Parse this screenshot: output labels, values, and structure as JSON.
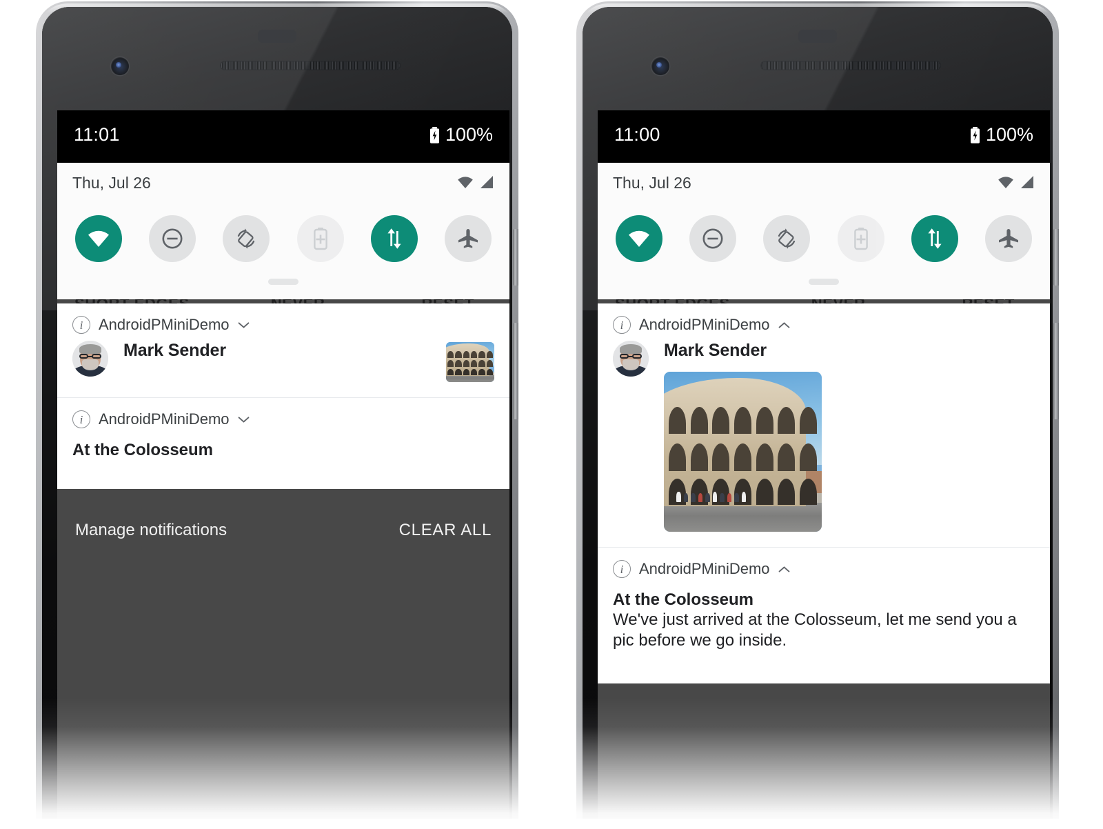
{
  "phones": [
    {
      "id": "left",
      "variant": "collapsed",
      "status_bar": {
        "time": "11:01",
        "battery": "100%",
        "battery_icon": "battery-charging-icon"
      },
      "background_app": {
        "buttons": [
          "SHORT EDGES",
          "NEVER",
          "RESET"
        ]
      },
      "quick_settings": {
        "date": "Thu, Jul 26",
        "status_icons": [
          "wifi-icon",
          "signal-icon"
        ],
        "tiles": [
          {
            "name": "wifi-tile",
            "icon": "wifi-icon",
            "state": "on"
          },
          {
            "name": "dnd-tile",
            "icon": "do-not-disturb-icon",
            "state": "off"
          },
          {
            "name": "auto-rotate-tile",
            "icon": "auto-rotate-icon",
            "state": "off"
          },
          {
            "name": "battery-saver-tile",
            "icon": "battery-plus-icon",
            "state": "disabled"
          },
          {
            "name": "mobile-data-tile",
            "icon": "data-transfer-icon",
            "state": "on"
          },
          {
            "name": "airplane-tile",
            "icon": "airplane-icon",
            "state": "off"
          }
        ]
      },
      "notifications": [
        {
          "app_name": "AndroidPMiniDemo",
          "expand_icon": "chevron-down-icon",
          "kind": "messaging",
          "sender": "Mark Sender",
          "avatar": "avatar-mark-sender",
          "thumbnail": "colosseum-photo"
        },
        {
          "app_name": "AndroidPMiniDemo",
          "expand_icon": "chevron-down-icon",
          "kind": "text",
          "title": "At the Colosseum",
          "body": ""
        }
      ],
      "footer": {
        "manage": "Manage notifications",
        "clear_all": "CLEAR ALL"
      }
    },
    {
      "id": "right",
      "variant": "expanded",
      "status_bar": {
        "time": "11:00",
        "battery": "100%",
        "battery_icon": "battery-charging-icon"
      },
      "background_app": {
        "buttons": [
          "SHORT EDGES",
          "NEVER",
          "RESET"
        ]
      },
      "quick_settings": {
        "date": "Thu, Jul 26",
        "status_icons": [
          "wifi-icon",
          "signal-icon"
        ],
        "tiles": [
          {
            "name": "wifi-tile",
            "icon": "wifi-icon",
            "state": "on"
          },
          {
            "name": "dnd-tile",
            "icon": "do-not-disturb-icon",
            "state": "off"
          },
          {
            "name": "auto-rotate-tile",
            "icon": "auto-rotate-icon",
            "state": "off"
          },
          {
            "name": "battery-saver-tile",
            "icon": "battery-plus-icon",
            "state": "disabled"
          },
          {
            "name": "mobile-data-tile",
            "icon": "data-transfer-icon",
            "state": "on"
          },
          {
            "name": "airplane-tile",
            "icon": "airplane-icon",
            "state": "off"
          }
        ]
      },
      "notifications": [
        {
          "app_name": "AndroidPMiniDemo",
          "expand_icon": "chevron-up-icon",
          "kind": "messaging-expanded",
          "sender": "Mark Sender",
          "avatar": "avatar-mark-sender",
          "big_picture": "colosseum-photo"
        },
        {
          "app_name": "AndroidPMiniDemo",
          "expand_icon": "chevron-up-icon",
          "kind": "text-expanded",
          "title": "At the Colosseum",
          "body": "We've just arrived at the Colosseum, let me send you a pic before we go inside."
        }
      ],
      "footer": {
        "manage": "",
        "clear_all": ""
      }
    }
  ],
  "colors": {
    "accent_teal": "#0d8c77",
    "tile_off": "#e1e2e3",
    "shade_scrim": "#1c1c1c",
    "notif_bg": "#ffffff",
    "text_primary": "#202124",
    "text_secondary": "#3c4043"
  }
}
